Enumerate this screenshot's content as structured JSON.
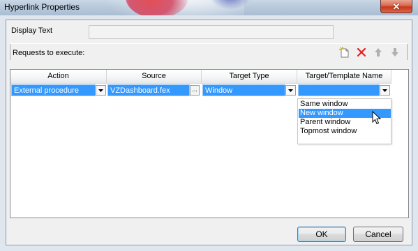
{
  "window": {
    "title": "Hyperlink Properties",
    "close_label": "✕"
  },
  "display_text": {
    "label": "Display Text",
    "value": ""
  },
  "requests": {
    "label": "Requests to execute:",
    "toolbar": [
      {
        "name": "new-request-icon",
        "color": "#d4b106"
      },
      {
        "name": "delete-request-icon",
        "color": "#e02020"
      },
      {
        "name": "move-up-icon",
        "color": "#b0b0b0"
      },
      {
        "name": "move-down-icon",
        "color": "#b0b0b0"
      }
    ]
  },
  "grid": {
    "columns": [
      "Action",
      "Source",
      "Target Type",
      "Target/Template Name"
    ],
    "row": {
      "action": "External procedure",
      "source": "VZDashboard.fex",
      "source_button": "...",
      "target_type": "Window",
      "target_name": ""
    }
  },
  "dropdown": {
    "options": [
      "Same window",
      "New window",
      "Parent window",
      "Topmost window"
    ],
    "selected": "New window"
  },
  "buttons": {
    "ok": "OK",
    "cancel": "Cancel"
  },
  "colors": {
    "selection": "#3399ff",
    "window_bg": "#f0f0f0",
    "accent_border": "#3c7fb1"
  }
}
